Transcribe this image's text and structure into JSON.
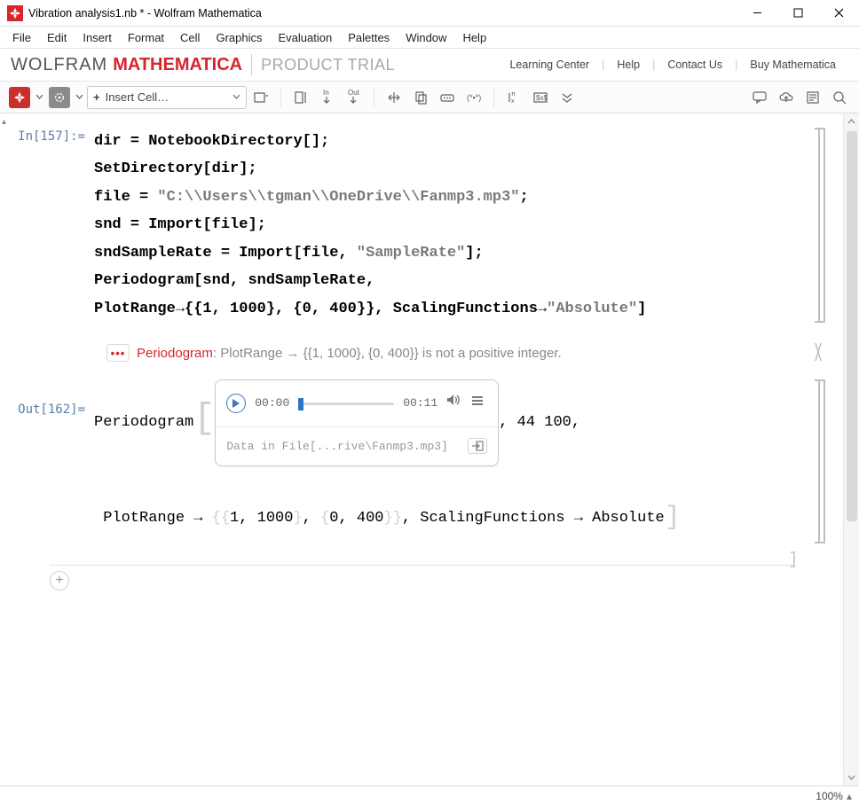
{
  "window": {
    "title": "Vibration analysis1.nb * - Wolfram Mathematica"
  },
  "menu": [
    "File",
    "Edit",
    "Insert",
    "Format",
    "Cell",
    "Graphics",
    "Evaluation",
    "Palettes",
    "Window",
    "Help"
  ],
  "brand": {
    "wolfram": "WOLFRAM",
    "mathematica": "MATHEMATICA",
    "trial": "PRODUCT TRIAL",
    "links": [
      "Learning Center",
      "Help",
      "Contact Us",
      "Buy Mathematica"
    ]
  },
  "toolbar": {
    "insert_cell": "Insert Cell…"
  },
  "cell_in": {
    "label": "In[157]:=",
    "line1_a": "dir",
    "line1_b": " = ",
    "line1_c": "NotebookDirectory",
    "line1_d": "[];",
    "line2_a": "SetDirectory",
    "line2_b": "[",
    "line2_c": "dir",
    "line2_d": "];",
    "line3_a": "file",
    "line3_b": " = ",
    "line3_c": "\"C:\\\\Users\\\\tgman\\\\OneDrive\\\\Fanmp3.mp3\"",
    "line3_d": ";",
    "line4_a": "snd",
    "line4_b": " = ",
    "line4_c": "Import",
    "line4_d": "[",
    "line4_e": "file",
    "line4_f": "];",
    "line5_a": "sndSampleRate",
    "line5_b": " = ",
    "line5_c": "Import",
    "line5_d": "[",
    "line5_e": "file",
    "line5_f": ", ",
    "line5_g": "\"SampleRate\"",
    "line5_h": "];",
    "line6_a": "Periodogram",
    "line6_b": "[",
    "line6_c": "snd",
    "line6_d": ", ",
    "line6_e": "sndSampleRate",
    "line6_f": ",",
    "line7_a": " PlotRange",
    "line7_b": " → ",
    "line7_c": "{{1, 1000}, {0, 400}}",
    "line7_d": ", ",
    "line7_e": "ScalingFunctions",
    "line7_f": " → ",
    "line7_g": "\"Absolute\"",
    "line7_h": "]"
  },
  "message": {
    "icon": "•••",
    "name": "Periodogram",
    "colon": ": ",
    "text": "PlotRange → {{1, 1000}, {0, 400}} is not a positive integer."
  },
  "cell_out": {
    "label": "Out[162]=",
    "pre": "Periodogram",
    "lbr": "[",
    "after_audio": ", 44 100,",
    "line2_a": "PlotRange → ",
    "line2_b": "{",
    "line2_c": "{",
    "line2_d": "1, 1000",
    "line2_e": "}",
    "line2_f": ", ",
    "line2_g": "{",
    "line2_h": "0, 400",
    "line2_i": "}",
    "line2_j": "}",
    "line2_k": ", ScalingFunctions → Absolute",
    "rbr": "]"
  },
  "audio": {
    "cur": "00:00",
    "dur": "00:11",
    "file": "Data in File[...rive\\Fanmp3.mp3]"
  },
  "status": {
    "zoom": "100%"
  }
}
